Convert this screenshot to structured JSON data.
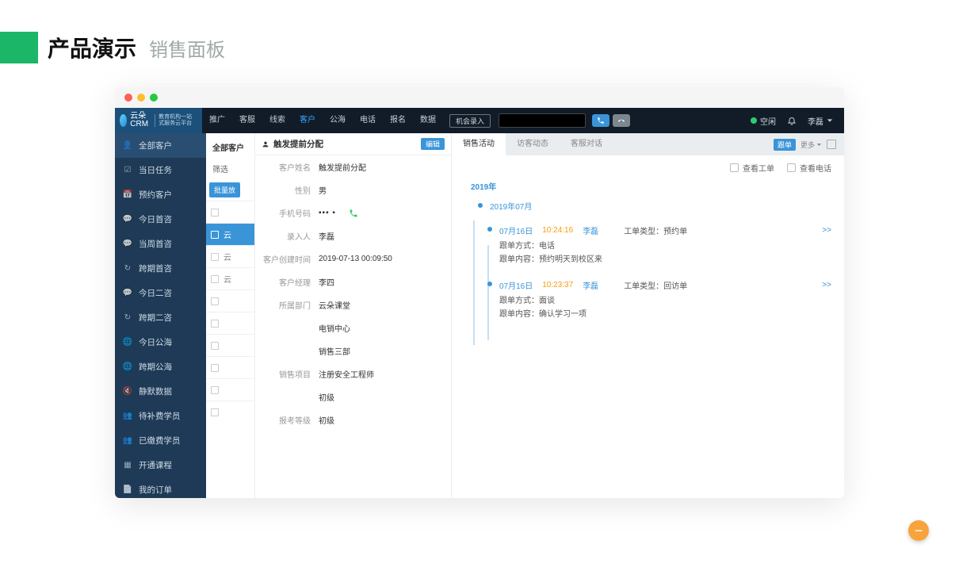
{
  "page": {
    "title": "产品演示",
    "subtitle": "销售面板"
  },
  "header": {
    "logo_main": "云朵CRM",
    "logo_sub": "教育机构一站式服务云平台",
    "nav": [
      "推广",
      "客服",
      "线索",
      "客户",
      "公海",
      "电话",
      "报名",
      "数据"
    ],
    "nav_active_index": 3,
    "opportunity_btn": "机会录入",
    "status_label": "空闲",
    "user_name": "李磊"
  },
  "sidebar": {
    "items": [
      "全部客户",
      "当日任务",
      "预约客户",
      "今日首咨",
      "当周首咨",
      "跨期首咨",
      "今日二咨",
      "跨期二咨",
      "今日公海",
      "跨期公海",
      "静默数据",
      "待补费学员",
      "已缴费学员",
      "开通课程",
      "我的订单"
    ],
    "active_index": 0
  },
  "main_list": {
    "title": "全部客户",
    "filter_label": "筛选",
    "batch_btn": "批量放",
    "rows": [
      "",
      "云",
      "云",
      "云",
      "",
      "",
      "",
      "",
      "",
      ""
    ],
    "selected_index": 1
  },
  "detail": {
    "title": "触发提前分配",
    "edit_label": "编辑",
    "rows": [
      {
        "label": "客户姓名",
        "value": "触发提前分配"
      },
      {
        "label": "性别",
        "value": "男"
      },
      {
        "label": "手机号码",
        "value": "",
        "phone_icon": true
      },
      {
        "label": "录入人",
        "value": "李磊"
      },
      {
        "label": "客户创建时间",
        "value": "2019-07-13 00:09:50"
      },
      {
        "label": "客户经理",
        "value": "李四"
      },
      {
        "label": "所属部门",
        "value": "云朵课堂"
      },
      {
        "label": "",
        "value": "电销中心"
      },
      {
        "label": "",
        "value": "销售三部"
      },
      {
        "label": "销售项目",
        "value": "注册安全工程师"
      },
      {
        "label": "",
        "value": "初级"
      },
      {
        "label": "报考等级",
        "value": "初级"
      }
    ]
  },
  "activity": {
    "tabs": [
      "销售活动",
      "访客动态",
      "客服对话"
    ],
    "active_tab": 0,
    "follow_badge": "跟单",
    "more_link": "更多",
    "check_ticket": "查看工单",
    "check_call": "查看电话",
    "year": "2019年",
    "month": "2019年07月",
    "entries": [
      {
        "date": "07月16日",
        "time": "10:24:16",
        "user": "李磊",
        "type_label": "工单类型：",
        "type_value": "预约单",
        "method_label": "跟单方式：",
        "method_value": "电话",
        "content_label": "跟单内容：",
        "content_value": "预约明天到校区来",
        "more": ">>"
      },
      {
        "date": "07月16日",
        "time": "10:23:37",
        "user": "李磊",
        "type_label": "工单类型：",
        "type_value": "回访单",
        "method_label": "跟单方式：",
        "method_value": "面谈",
        "content_label": "跟单内容：",
        "content_value": "确认学习一项",
        "more": ">>"
      }
    ]
  }
}
